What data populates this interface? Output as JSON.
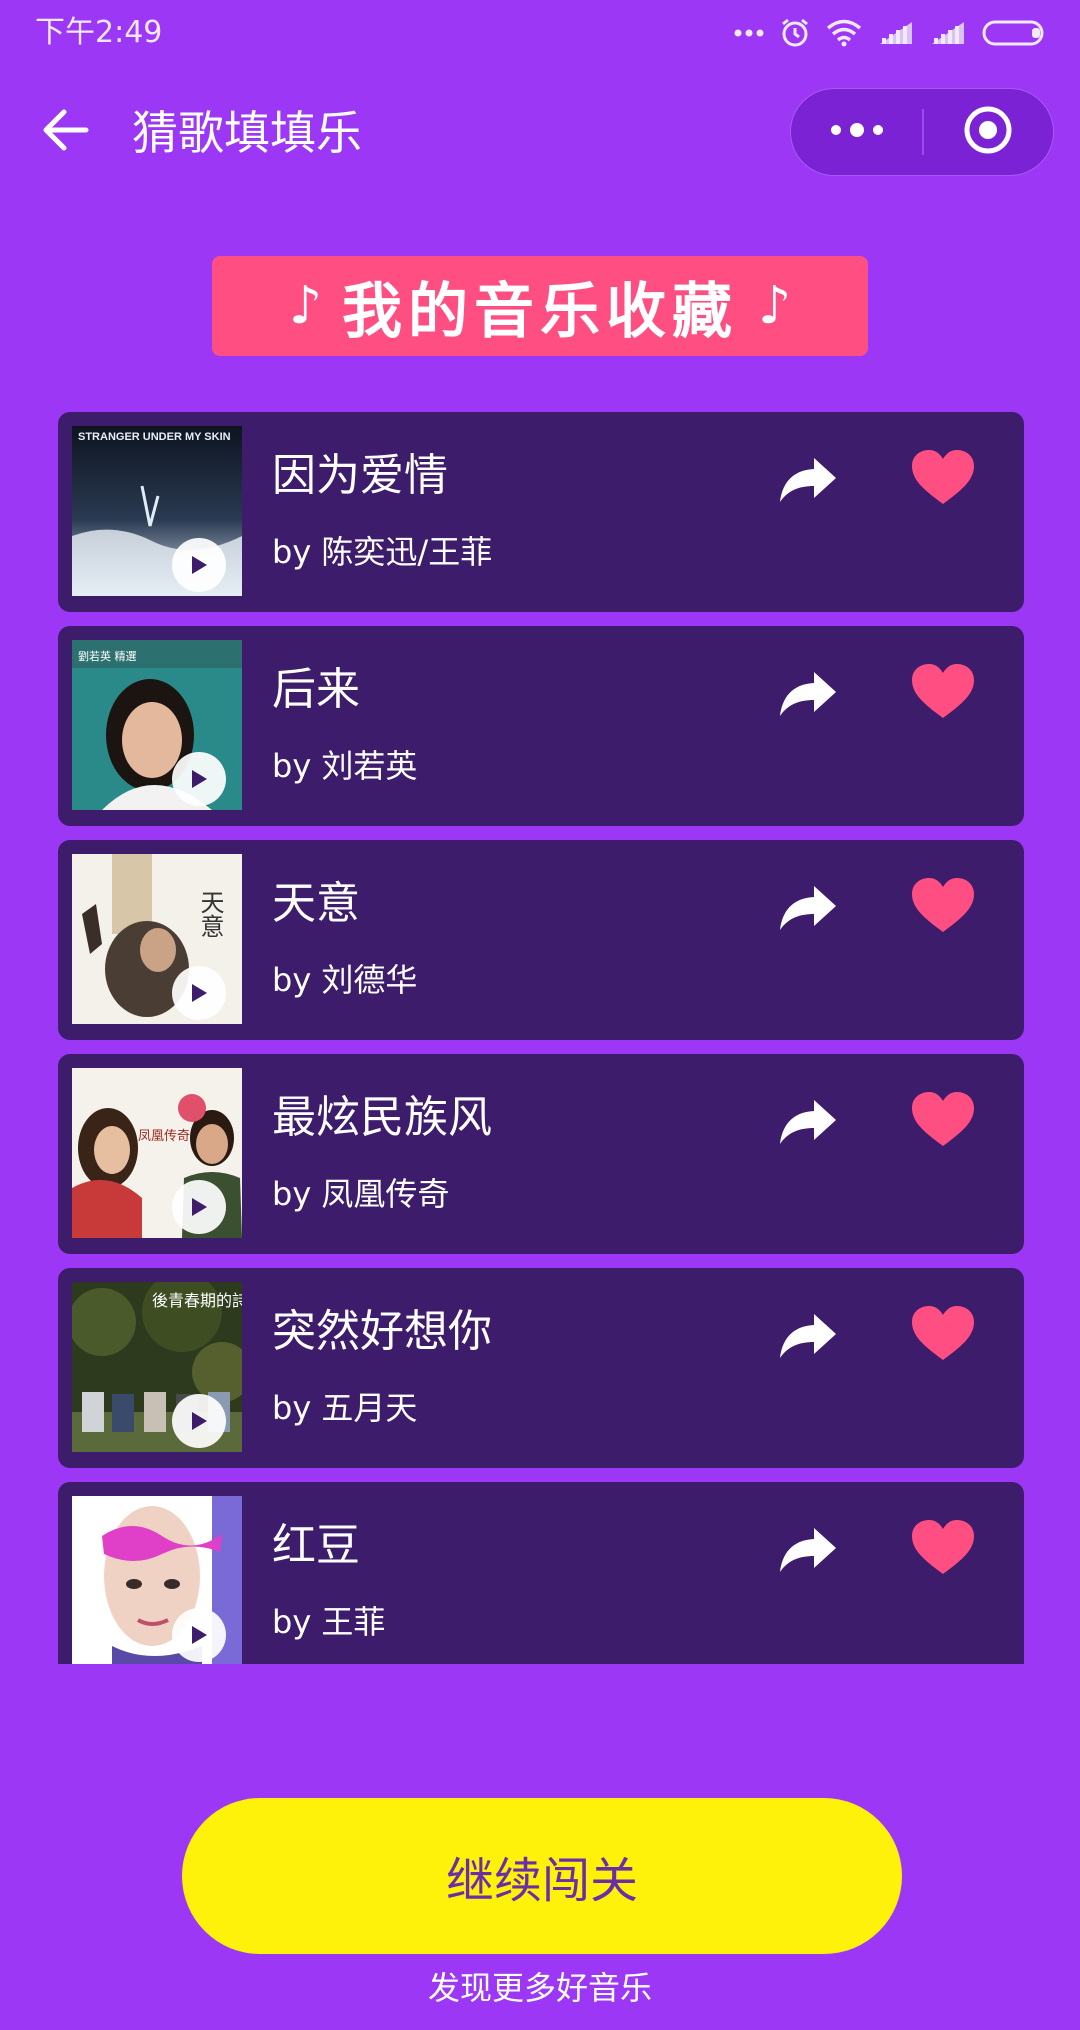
{
  "status_bar": {
    "time": "下午2:49",
    "icons": [
      "more-dots-icon",
      "alarm-icon",
      "wifi-icon",
      "signal-icon",
      "signal-icon",
      "battery-icon"
    ]
  },
  "nav": {
    "title": "猜歌填填乐",
    "back_icon": "arrow-left-icon",
    "more_icon": "more-dots-icon",
    "close_icon": "target-circle-icon"
  },
  "banner": {
    "text": "我的音乐收藏",
    "note_icon": "♪",
    "background": "#ff4f82"
  },
  "songs": [
    {
      "title": "因为爱情",
      "artist": "by 陈奕迅/王菲",
      "cover_text": "STRANGER UNDER MY SKIN"
    },
    {
      "title": "后来",
      "artist": "by 刘若英",
      "cover_text": "劉若英 精選"
    },
    {
      "title": "天意",
      "artist": "by 刘德华",
      "cover_text": "天意"
    },
    {
      "title": "最炫民族风",
      "artist": "by 凤凰传奇",
      "cover_text": "凤凰传奇"
    },
    {
      "title": "突然好想你",
      "artist": "by 五月天",
      "cover_text": "後青春期的詩"
    },
    {
      "title": "红豆",
      "artist": "by 王菲",
      "cover_text": ""
    }
  ],
  "actions": {
    "continue_label": "继续闯关",
    "discover_label": "发现更多好音乐"
  },
  "colors": {
    "background": "#9b37f5",
    "card": "#3d1c6b",
    "heart": "#ff4f82",
    "button": "#fff20a",
    "button_text": "#6a2fa8"
  }
}
